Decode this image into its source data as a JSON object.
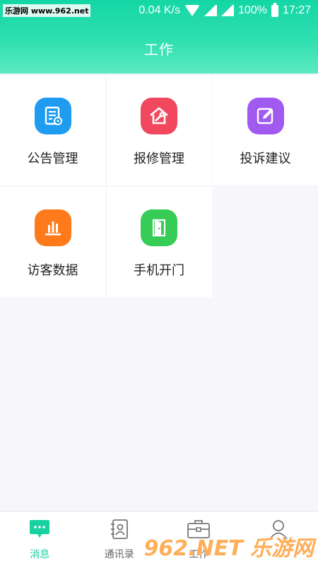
{
  "status_bar": {
    "watermark": "乐游网 www.962.net",
    "speed": "0.04 K/s",
    "battery": "100%",
    "time": "17:27"
  },
  "header": {
    "title": "工作"
  },
  "grid": {
    "items": [
      {
        "label": "公告管理",
        "icon": "announcement-icon",
        "color": "#1f9bf0"
      },
      {
        "label": "报修管理",
        "icon": "repair-icon",
        "color": "#f2485f"
      },
      {
        "label": "投诉建议",
        "icon": "complaint-icon",
        "color": "#a15af0"
      },
      {
        "label": "访客数据",
        "icon": "visitor-data-icon",
        "color": "#ff7a1a"
      },
      {
        "label": "手机开门",
        "icon": "door-icon",
        "color": "#36cc55"
      }
    ]
  },
  "bottom_nav": {
    "items": [
      {
        "label": "消息",
        "icon": "message-icon",
        "active": true
      },
      {
        "label": "通讯录",
        "icon": "contacts-icon",
        "active": false
      },
      {
        "label": "工作",
        "icon": "briefcase-icon",
        "active": false
      }
    ]
  },
  "watermark_bottom": "962.NET 乐游网",
  "colors": {
    "accent": "#18d0a0",
    "header_top": "#14d6a5",
    "header_bottom": "#5ceac2"
  }
}
